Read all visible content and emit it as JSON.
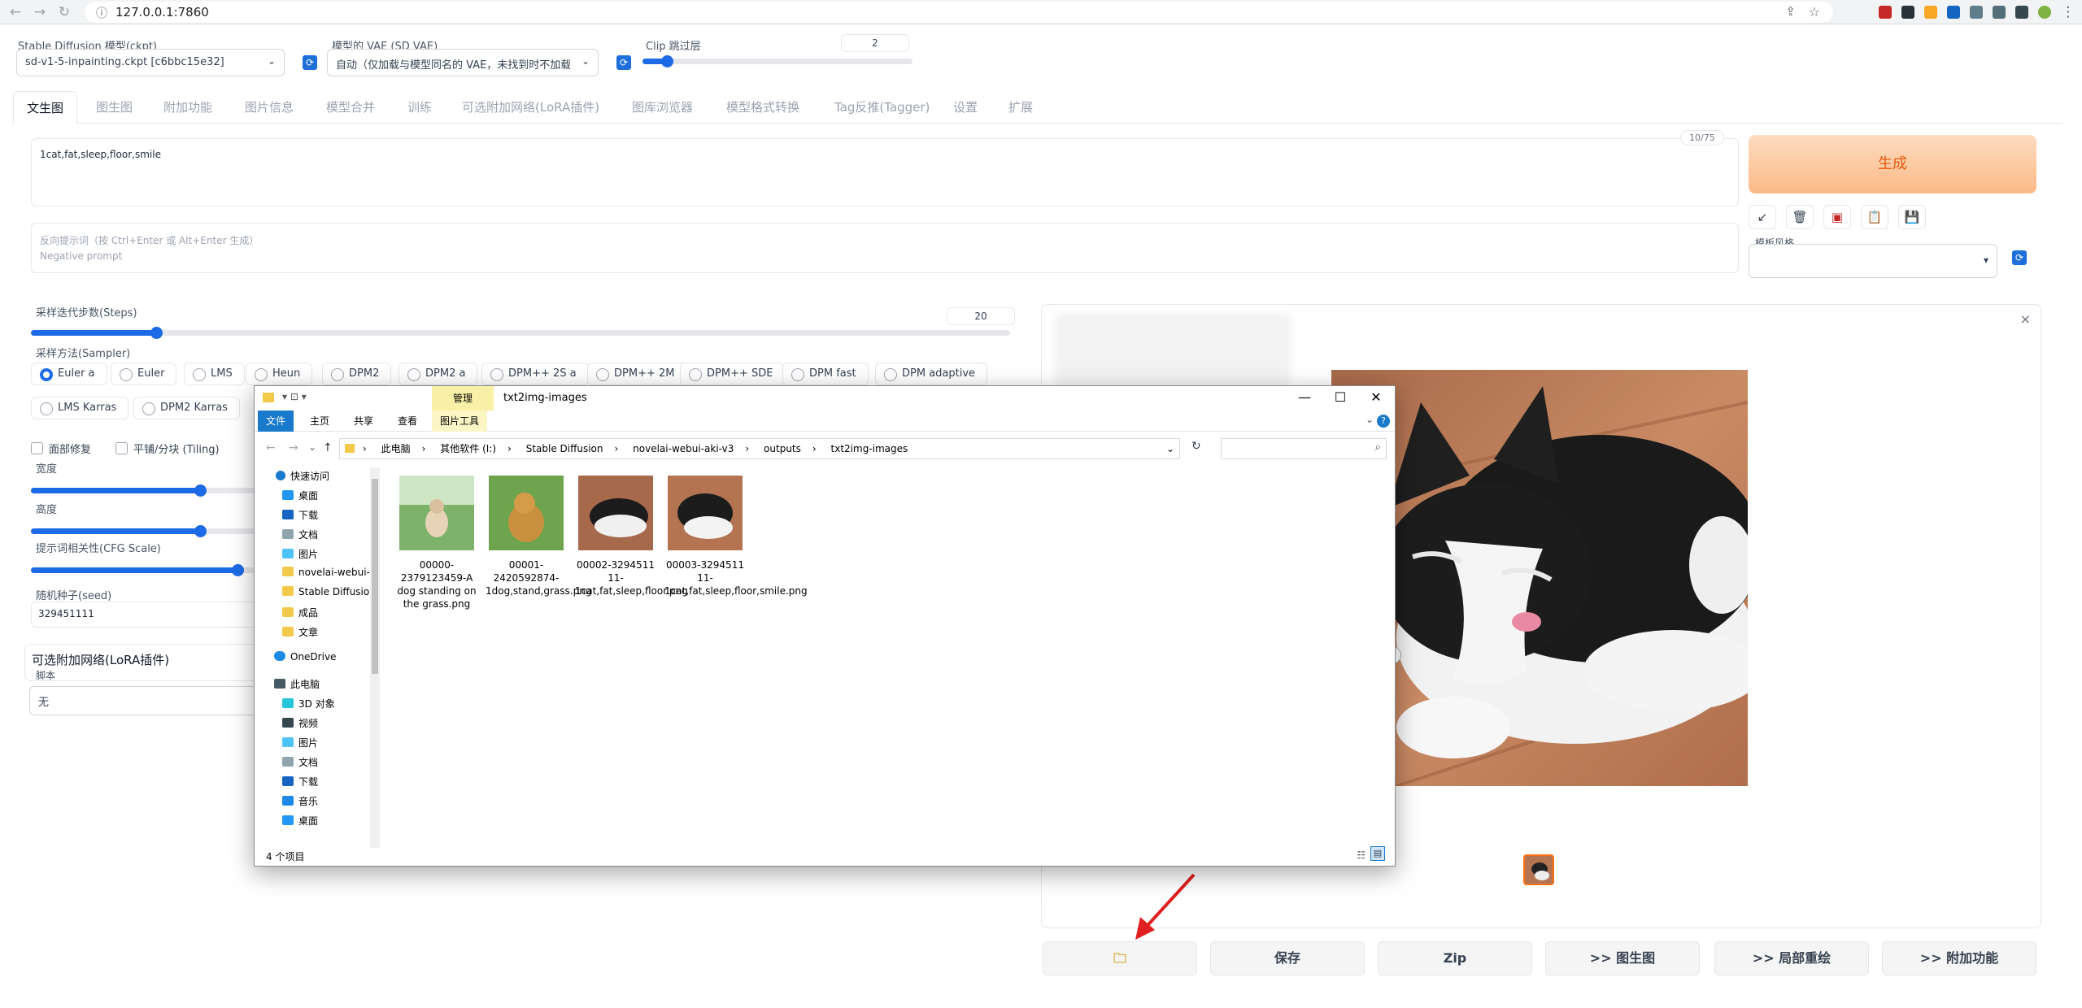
{
  "browser": {
    "url": "127.0.0.1:7860"
  },
  "settings": {
    "model_label": "Stable Diffusion 模型(ckpt)",
    "model_value": "sd-v1-5-inpainting.ckpt [c6bbc15e32]",
    "vae_label": "模型的 VAE (SD VAE)",
    "vae_value": "自动（仅加载与模型同名的 VAE，未找到时不加载）",
    "clip_label": "Clip 跳过层",
    "clip_value": "2",
    "clip_slider": {
      "min": 1,
      "max": 12,
      "value": 2
    }
  },
  "tabs": [
    "文生图",
    "图生图",
    "附加功能",
    "图片信息",
    "模型合并",
    "训练",
    "可选附加网络(LoRA插件)",
    "图库浏览器",
    "模型格式转换",
    "Tag反推(Tagger)",
    "设置",
    "扩展"
  ],
  "prompt": {
    "text": "1cat,fat,sleep,floor,smile",
    "counter": "10/75",
    "negative_placeholder_1": "反向提示词（按 Ctrl+Enter 或 Alt+Enter 生成）",
    "negative_placeholder_2": "Negative prompt"
  },
  "actions": {
    "generate": "生成",
    "style_label": "模板风格"
  },
  "params": {
    "steps_label": "采样迭代步数(Steps)",
    "steps_value": "20",
    "steps_slider": {
      "min": 1,
      "max": 150,
      "value": 20
    },
    "sampler_label": "采样方法(Sampler)",
    "samplers_row1": [
      "Euler a",
      "Euler",
      "LMS",
      "Heun",
      "DPM2",
      "DPM2 a",
      "DPM++ 2S a",
      "DPM++ 2M",
      "DPM++ SDE",
      "DPM fast",
      "DPM adaptive"
    ],
    "samplers_row2": [
      "LMS Karras",
      "DPM2 Karras"
    ],
    "face_restore": "面部修复",
    "tiling": "平铺/分块 (Tiling)",
    "width_label": "宽度",
    "height_label": "高度",
    "cfg_label": "提示词相关性(CFG Scale)",
    "seed_label": "随机种子(seed)",
    "seed_value": "329451111",
    "lora_label": "可选附加网络(LoRA插件)",
    "script_label": "脚本",
    "script_value": "无"
  },
  "output_buttons": [
    "保存",
    "Zip",
    ">> 图生图",
    ">> 局部重绘",
    ">> 附加功能"
  ],
  "explorer": {
    "title": "txt2img-images",
    "manage": "管理",
    "ribbon": [
      "文件",
      "主页",
      "共享",
      "查看",
      "图片工具"
    ],
    "path": [
      "此电脑",
      "其他软件 (I:)",
      "Stable Diffusion",
      "novelai-webui-aki-v3",
      "outputs",
      "txt2img-images"
    ],
    "quick_access": "快速访问",
    "tree": [
      "桌面",
      "下载",
      "文档",
      "图片",
      "novelai-webui-",
      "Stable Diffusion",
      "成品",
      "文章"
    ],
    "onedrive": "OneDrive",
    "this_pc": "此电脑",
    "pc_tree": [
      "3D 对象",
      "视频",
      "图片",
      "文档",
      "下载",
      "音乐",
      "桌面"
    ],
    "files": [
      "00000-2379123459-A dog standing on the grass.png",
      "00001-2420592874-1dog,stand,grass.png",
      "00002-3294511 11-1cat,fat,sleep,floor.png",
      "00003-3294511 11-1cat,fat,sleep,floor,smile.png"
    ],
    "status": "4 个项目"
  },
  "colors": {
    "accent": "#1d6ae6",
    "generate_text": "#ea580c",
    "arrow": "#e02020"
  }
}
